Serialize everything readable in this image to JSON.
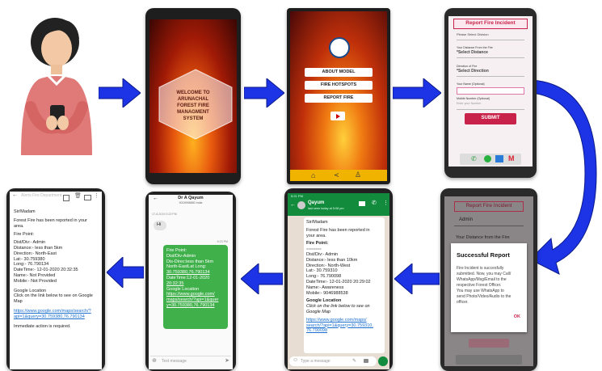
{
  "splash": {
    "lines": [
      "WELCOME TO",
      "ARUNACHAL",
      "FOREST FIRE",
      "MANAGMENT",
      "SYSTEM"
    ]
  },
  "menu": {
    "buttons": [
      "ABOUT MODEL",
      "FIRE HOTSPOTS",
      "REPORT FIRE"
    ]
  },
  "report_form": {
    "title": "Report Fire Incident",
    "district_placeholder": "Please Select Division",
    "distance_label": "Your Distance From the Fire",
    "distance_value": "Select Distance",
    "direction_label": "Direction of Fire",
    "direction_value": "Select Direction",
    "name_label": "Your Name (Optional)",
    "mobile_label": "Mobile Number (Optional)",
    "mobile_placeholder": "Enter your Number",
    "submit_label": "SUBMIT"
  },
  "success_screen": {
    "title": "Report Fire Incident",
    "admin": "Admin",
    "distance_label": "Your Distance from the Fire",
    "dialog_title": "Successful Report",
    "dialog_lines": [
      "Fire Incident is succesfully",
      "submitted. Now, you may Call/",
      "WhatsApp/Msg/Email to the",
      "respective Forest Officer.",
      "You may use WhatsApp to",
      "send Photo/Video/Audio to the",
      "officer."
    ],
    "ok": "OK"
  },
  "whatsapp": {
    "status_time": "5:21 PM",
    "contact": "Qayum",
    "last_seen": "last seen today at 5:08 pm",
    "greeting": "Sir/Madam",
    "intro": [
      "Forest Fire has been reported in",
      "your area."
    ],
    "fire_point": "Fire Point:",
    "separator": "========",
    "details": [
      "Dist/Div:- Admin",
      "Distance:- less than 10km",
      "Direction:- North-West",
      "Lat:- 30.759310",
      "Long:- 76.790098",
      "DateTime:- 12-01-2020 20:29:02",
      "Name:- Awareness",
      "Mobile:- 9046988538"
    ],
    "google_location": "Google Location",
    "google_hint": [
      "Click on the link below to see on",
      "Google Map"
    ],
    "map_link": [
      "https://www.google.com/maps/",
      "search/?api=1&query=30.759310,",
      "76.790098"
    ],
    "input_placeholder": "Type a message"
  },
  "sms": {
    "contact": "Dr A Qayum",
    "number": "9018998880 India",
    "date": "17-8-2019 0:23 PM",
    "hi": "Hi",
    "time": "8:23 PM",
    "lines": [
      "Fire Point:",
      "Dist/Div-Admin",
      "Dis-Direc:less than 5km",
      "North-EastLat Long:",
      "30.759380,76.790134",
      "DateTime:12-01-2020",
      "20:32:35",
      "Google Location",
      "https://www.google.com/",
      "maps/search/?api=1&quer",
      "y=30.759380,76.790134"
    ],
    "input_placeholder": "Text message"
  },
  "email": {
    "sender": "Alerts Fire Department",
    "greeting": "Sir/Madam",
    "intro": [
      "Forest Fire has been reported in your",
      "area."
    ],
    "fire_point": "Fire Point:",
    "details": [
      "Dist/Div:- Admin",
      "Distance:- less than 5km",
      "Direction:- North-East",
      "Lat:- 30.759380",
      "Long:- 76.790134",
      "DateTime:- 12-01-2020 20:32:35",
      "Name:- Not Provided",
      "Mobile:- Not Provided"
    ],
    "google_location": "Google Location",
    "google_hint": [
      "Click on the link below to see on Google",
      "Map"
    ],
    "map_link": [
      "https://www.google.com/maps/search/?",
      "api=1&query=30.759380,76.790134"
    ],
    "footer": "Immediate action is required."
  },
  "colors": {
    "arrow": "#1c34e6",
    "submit": "#c9224a",
    "whatsapp_green": "#128c3c",
    "sms_bubble": "#3fb04a"
  }
}
